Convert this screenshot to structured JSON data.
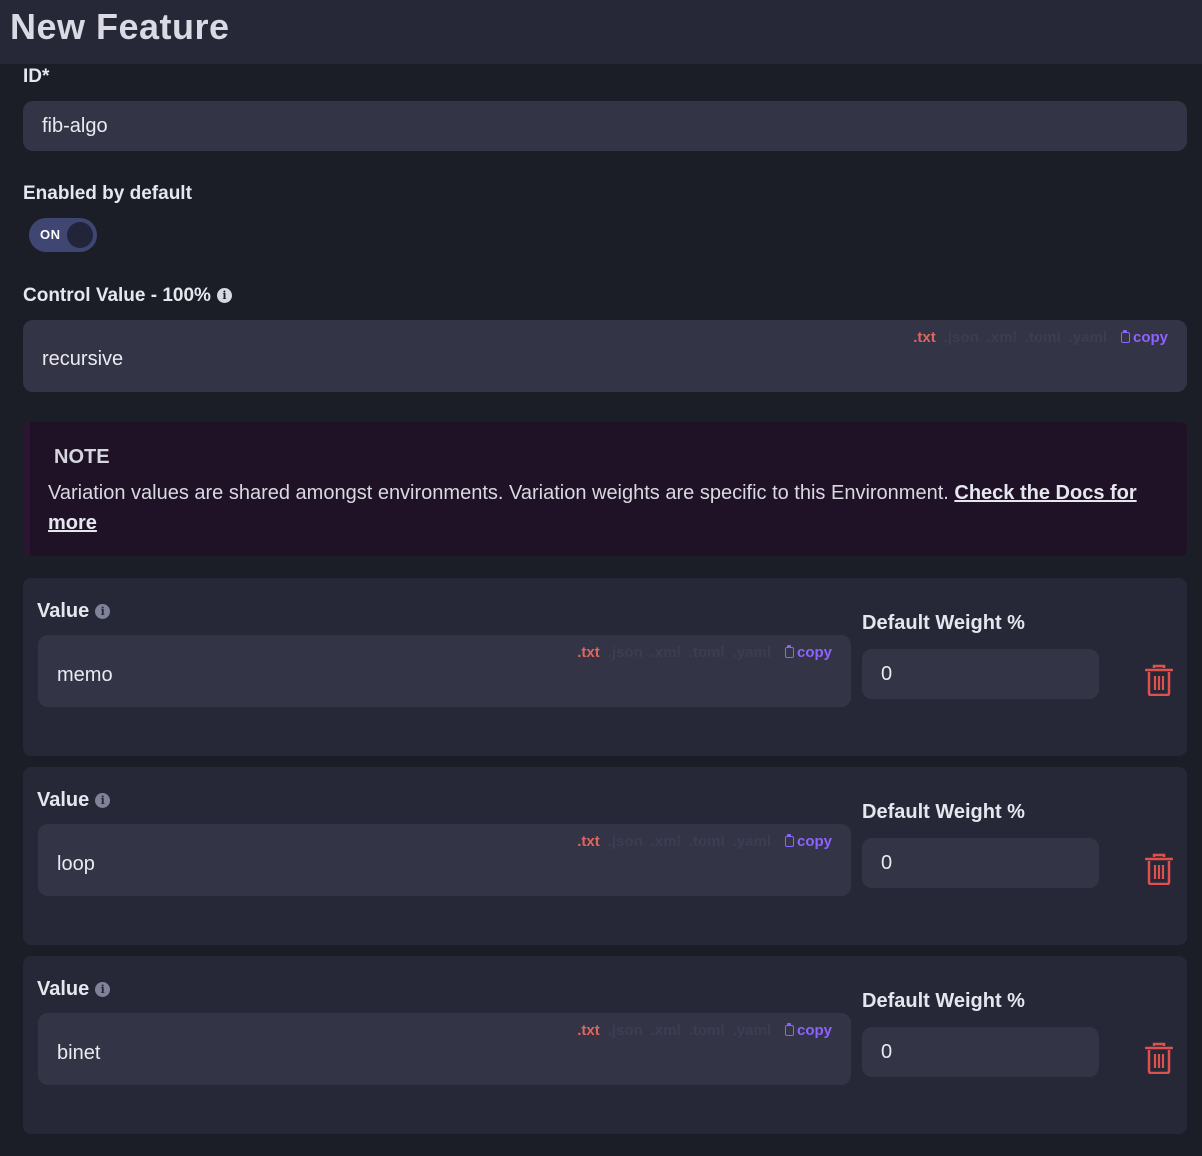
{
  "header": {
    "title": "New Feature"
  },
  "id_field": {
    "label": "ID*",
    "value": "fib-algo"
  },
  "enabled": {
    "label": "Enabled by default",
    "state": "ON"
  },
  "control": {
    "label": "Control Value - 100%",
    "value": "recursive",
    "formats": [
      ".txt",
      ".json",
      ".xml",
      ".toml",
      ".yaml"
    ],
    "copy_label": "copy"
  },
  "note": {
    "title": "NOTE",
    "text": "Variation values are shared amongst environments. Variation weights are specific to this Environment. ",
    "link": "Check the Docs for more"
  },
  "variations": [
    {
      "value_label": "Value",
      "value": "memo",
      "weight_label": "Default Weight %",
      "weight": "0"
    },
    {
      "value_label": "Value",
      "value": "loop",
      "weight_label": "Default Weight %",
      "weight": "0"
    },
    {
      "value_label": "Value",
      "value": "binet",
      "weight_label": "Default Weight %",
      "weight": "0"
    }
  ],
  "colors": {
    "background": "#1b1d27",
    "card": "#262837",
    "field": "#343447",
    "txt_active": "#e0655a",
    "copy": "#8d63ff",
    "trash": "#e0514d",
    "toggle": "#3f4672"
  }
}
